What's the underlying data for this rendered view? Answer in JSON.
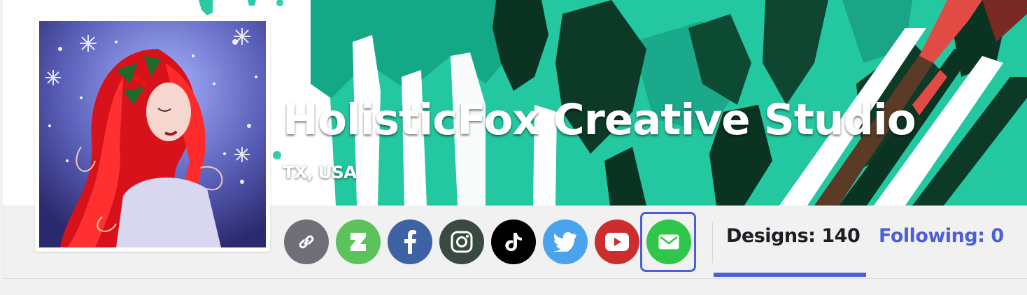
{
  "profile": {
    "name": "HolisticFox Creative Studio",
    "location": "TX, USA",
    "avatar_icon": "avatar-red-hair-winter-art"
  },
  "social_links": [
    {
      "name": "website-link-icon",
      "color": "#6f6f78"
    },
    {
      "name": "deviantart-icon",
      "color": "#5cc25c"
    },
    {
      "name": "facebook-icon",
      "color": "#3e62a4"
    },
    {
      "name": "instagram-icon",
      "color": "#3a4a40"
    },
    {
      "name": "tiktok-icon",
      "color": "#000000"
    },
    {
      "name": "twitter-icon",
      "color": "#4aa3ec"
    },
    {
      "name": "youtube-icon",
      "color": "#cc2e2e"
    },
    {
      "name": "email-icon",
      "color": "#2fc64a",
      "focused": true
    }
  ],
  "tabs": {
    "designs": "Designs: 140",
    "following": "Following: 0",
    "active": "designs"
  },
  "colors": {
    "accent": "#4a5fd8",
    "banner_green": "#22c9a2",
    "banner_dark": "#0a3322",
    "banner_red": "#e24a44"
  }
}
